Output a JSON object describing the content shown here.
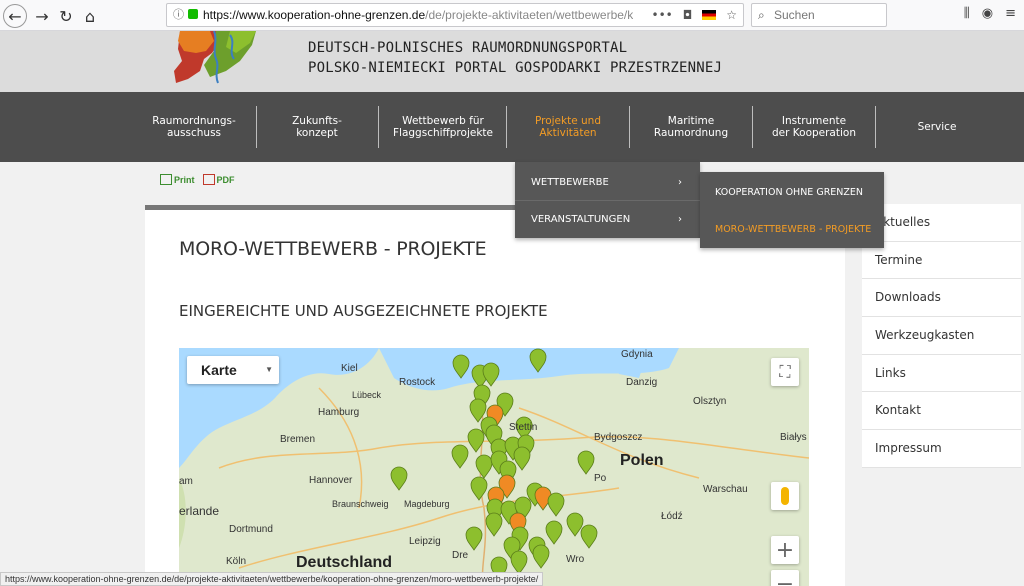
{
  "browser": {
    "url_domain": "https://www.kooperation-ohne-grenzen.de",
    "url_rest": "/de/projekte-aktivitaeten/wettbewerbe/kooperat",
    "search_placeholder": "Suchen",
    "status_url": "https://www.kooperation-ohne-grenzen.de/de/projekte-aktivitaeten/wettbewerbe/kooperation-ohne-grenzen/moro-wettbewerb-projekte/"
  },
  "header": {
    "title_line_1": "DEUTSCH-POLNISCHES RAUMORDNUNGSPORTAL",
    "title_line_2": "POLSKO-NIEMIECKI PORTAL GOSPODARKI PRZESTRZENNEJ"
  },
  "nav": {
    "items": [
      {
        "line1": "Raumordnungs-",
        "line2": "ausschuss"
      },
      {
        "line1": "Zukunfts-",
        "line2": "konzept"
      },
      {
        "line1": "Wettbewerb für",
        "line2": "Flaggschiffprojekte"
      },
      {
        "line1": "Projekte und",
        "line2": "Aktivitäten"
      },
      {
        "line1": "Maritime",
        "line2": "Raumordnung"
      },
      {
        "line1": "Instrumente",
        "line2": "der Kooperation"
      },
      {
        "line1": "Service",
        "line2": ""
      }
    ]
  },
  "dropdown": {
    "items": [
      "WETTBEWERBE",
      "VERANSTALTUNGEN"
    ],
    "arrow": "›"
  },
  "subdropdown": {
    "items": [
      "KOOPERATION OHNE GRENZEN",
      "MORO-WETTBEWERB - PROJEKTE"
    ]
  },
  "toolbar": {
    "print_label": "Print",
    "pdf_label": "PDF"
  },
  "content": {
    "title": "MORO-WETTBEWERB - PROJEKTE",
    "subtitle": "EINGEREICHTE UND AUSGEZEICHNETE PROJEKTE"
  },
  "map": {
    "type_label": "Karte",
    "labels": [
      {
        "text": "Gdynia",
        "big": false
      },
      {
        "text": "Kiel",
        "big": false
      },
      {
        "text": "Rostock",
        "big": false
      },
      {
        "text": "Danzig",
        "big": false
      },
      {
        "text": "Lübeck",
        "big": false
      },
      {
        "text": "Olsztyn",
        "big": false
      },
      {
        "text": "Hamburg",
        "big": false
      },
      {
        "text": "Stettin",
        "big": false
      },
      {
        "text": "Bremen",
        "big": false
      },
      {
        "text": "Bydgoszcz",
        "big": false
      },
      {
        "text": "Białys",
        "big": false
      },
      {
        "text": "Polen",
        "big": true
      },
      {
        "text": "Hannover",
        "big": false
      },
      {
        "text": "Po",
        "big": false
      },
      {
        "text": "Warschau",
        "big": false
      },
      {
        "text": "Braunschweig",
        "big": false
      },
      {
        "text": "Magdeburg",
        "big": false
      },
      {
        "text": "erlande",
        "big": false
      },
      {
        "text": "Łódź",
        "big": false
      },
      {
        "text": "Dortmund",
        "big": false
      },
      {
        "text": "Leipzig",
        "big": false
      },
      {
        "text": "Köln",
        "big": false
      },
      {
        "text": "Deutschland",
        "big": true
      },
      {
        "text": "Dre",
        "big": false
      },
      {
        "text": "Wro",
        "big": false
      },
      {
        "text": "am",
        "big": false
      }
    ]
  },
  "sidebar": {
    "items": [
      "Aktuelles",
      "Termine",
      "Downloads",
      "Werkzeugkasten",
      "Links",
      "Kontakt",
      "Impressum"
    ]
  },
  "colors": {
    "accent": "#f39c25",
    "nav_bg": "#4d4d4d",
    "marker_green": "#8dbf2e",
    "marker_orange": "#f08a24"
  }
}
